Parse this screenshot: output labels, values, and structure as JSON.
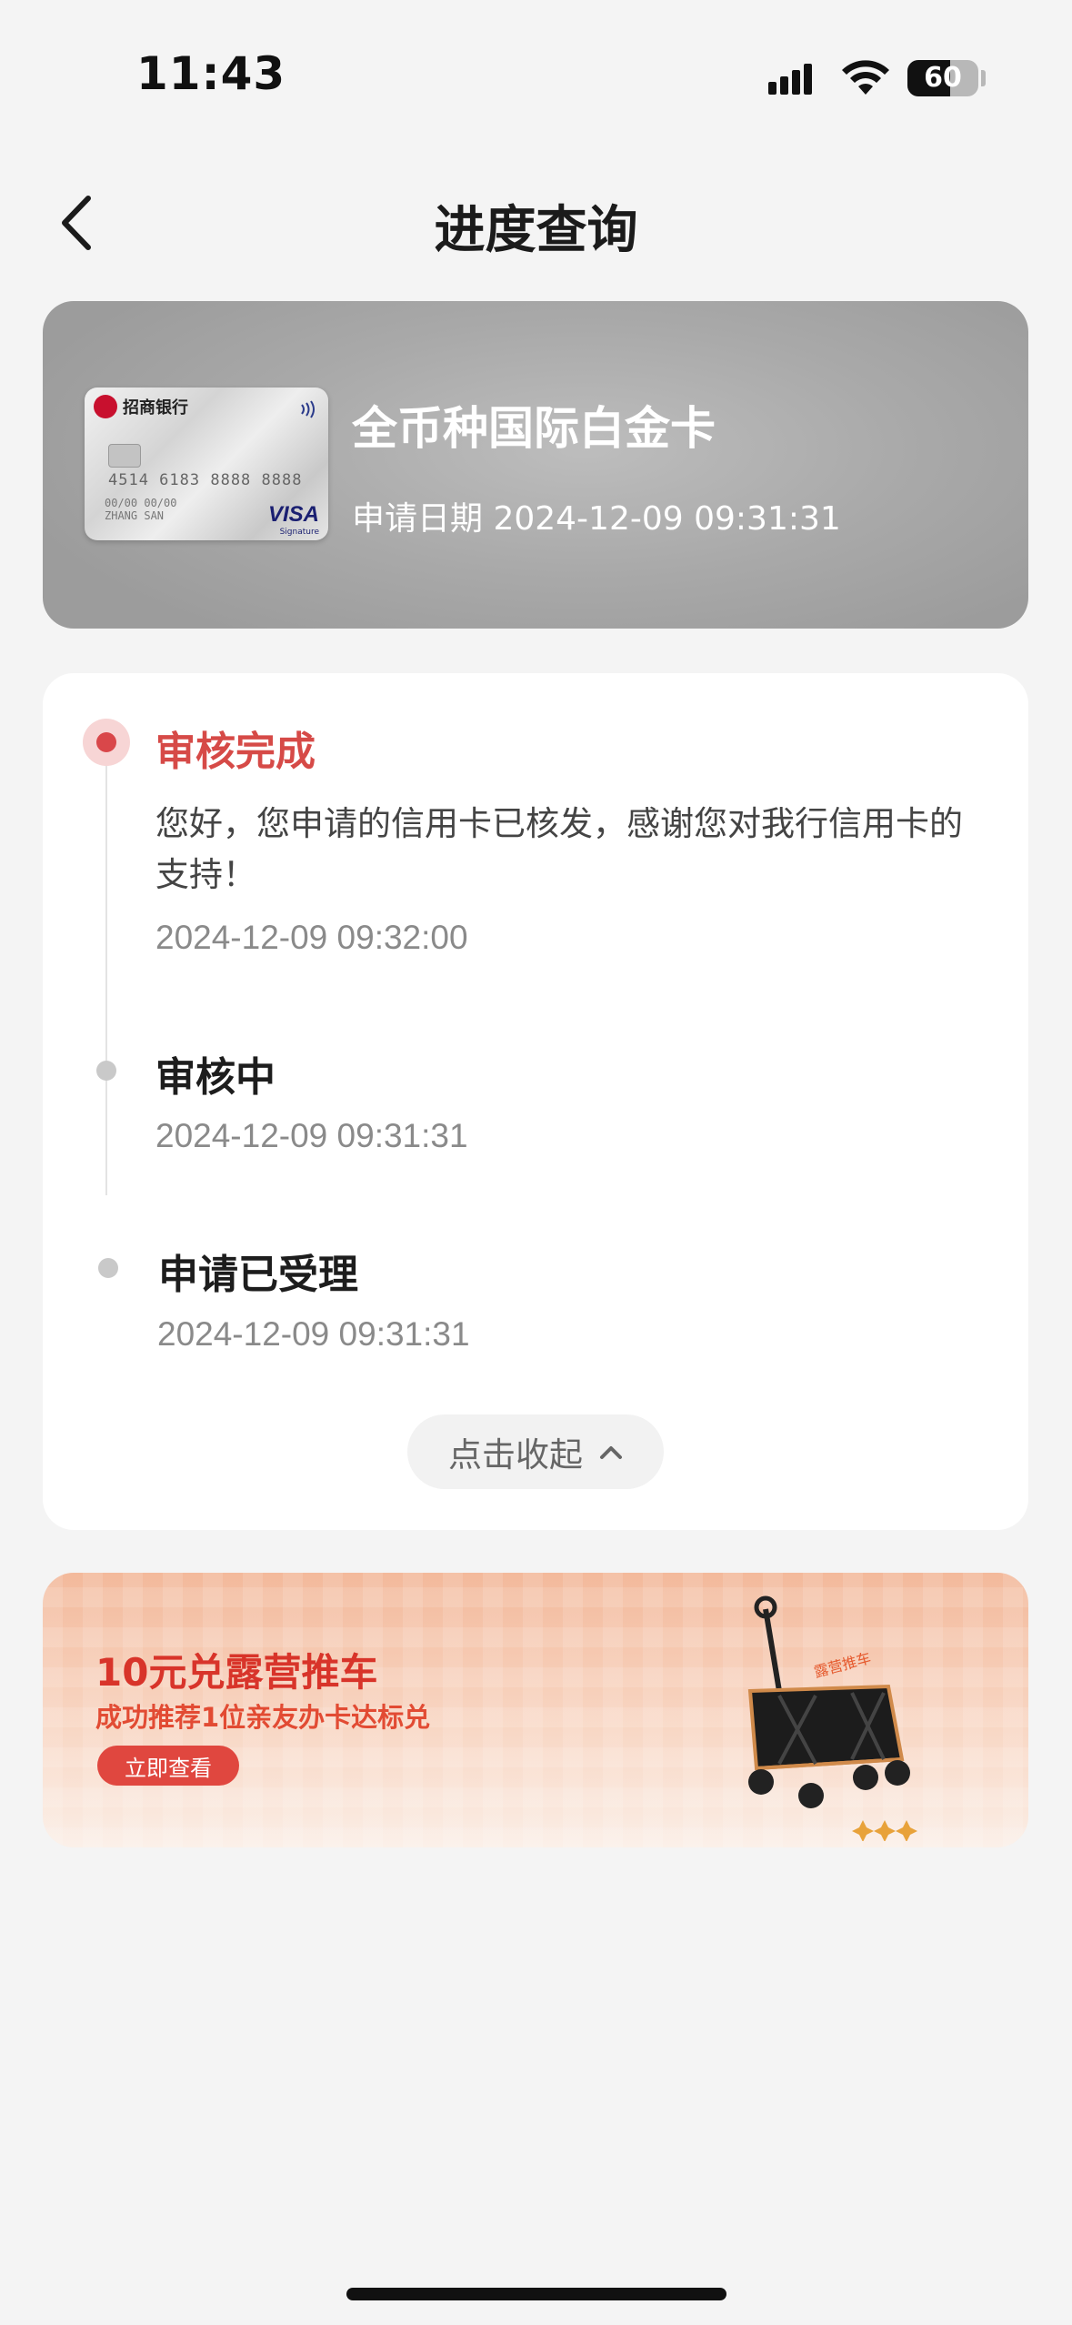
{
  "status_bar": {
    "time": "11:43",
    "battery_level": 60,
    "battery_text": "60",
    "icons": [
      "signal-icon",
      "wifi-icon",
      "battery-icon"
    ]
  },
  "nav": {
    "title": "进度查询",
    "back_icon": "chevron-left-icon"
  },
  "card": {
    "name": "全币种国际白金卡",
    "apply_date": "申请日期 2024-12-09 09:31:31",
    "image": {
      "bank_name": "招商银行",
      "number": "4514 6183 8888 8888",
      "holder_line1": "00/00  00/00",
      "holder_line2": "ZHANG SAN",
      "brand": "VISA",
      "brand_sub": "Signature"
    }
  },
  "progress": {
    "steps": [
      {
        "title": "审核完成",
        "description": "您好，您申请的信用卡已核发，感谢您对我行信用卡的支持！",
        "time": "2024-12-09 09:32:00",
        "status": "active"
      },
      {
        "title": "审核中",
        "time": "2024-12-09 09:31:31",
        "status": "done"
      },
      {
        "title": "申请已受理",
        "time": "2024-12-09 09:31:31",
        "status": "done"
      }
    ],
    "collapse_label": "点击收起",
    "collapse_icon": "chevron-up-icon"
  },
  "banner": {
    "title": "10元兑露营推车",
    "subtitle": "成功推荐1位亲友办卡达标兑",
    "button_label": "立即查看",
    "image": "camping-wagon-image"
  },
  "colors": {
    "accent": "#d64a47",
    "background": "#f4f4f4",
    "banner_button": "#e0473f"
  }
}
